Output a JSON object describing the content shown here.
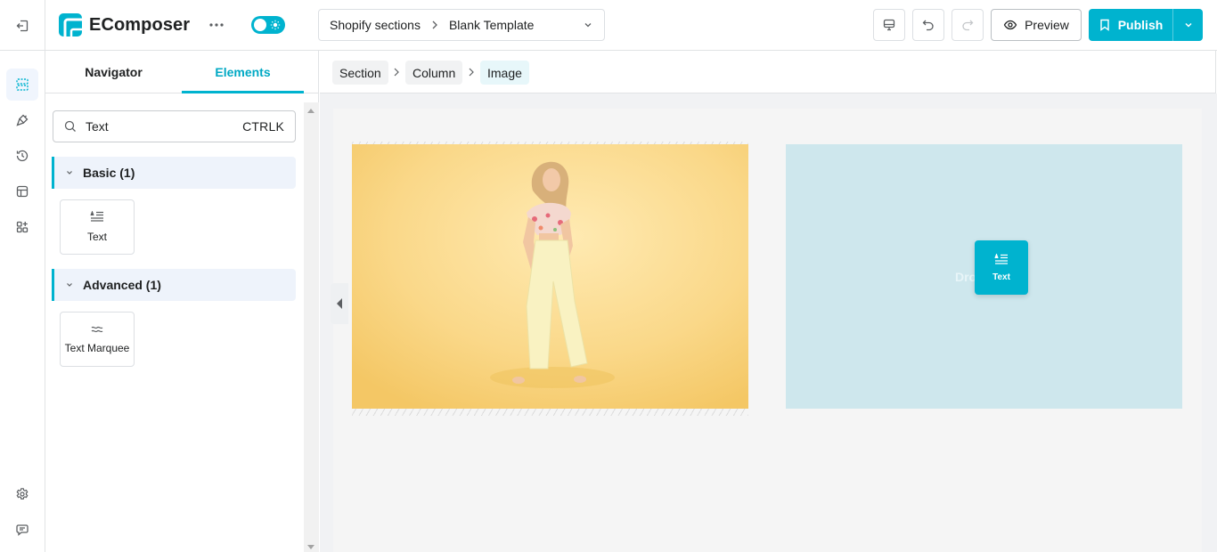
{
  "app": {
    "name": "EComposer",
    "brand_color": "#00b3cf",
    "theme_toggle": {
      "state": "on",
      "icon": "sun-icon"
    }
  },
  "header": {
    "template_selector": {
      "parent": "Shopify sections",
      "current": "Blank Template"
    },
    "actions": {
      "device_icon": "desktop-icon",
      "undo_icon": "undo-icon",
      "redo_icon": "redo-icon",
      "preview_label": "Preview",
      "publish_label": "Publish"
    }
  },
  "rail": {
    "items": [
      {
        "name": "layers",
        "icon": "sections-icon",
        "active": true
      },
      {
        "name": "styles",
        "icon": "brush-icon",
        "active": false
      },
      {
        "name": "history",
        "icon": "history-icon",
        "active": false
      },
      {
        "name": "layout",
        "icon": "layout-icon",
        "active": false
      },
      {
        "name": "apps",
        "icon": "add-apps-icon",
        "active": false
      }
    ],
    "bottom": [
      {
        "name": "settings",
        "icon": "gear-icon"
      },
      {
        "name": "chat",
        "icon": "chat-icon"
      }
    ]
  },
  "panel": {
    "tabs": [
      {
        "label": "Navigator",
        "active": false
      },
      {
        "label": "Elements",
        "active": true
      }
    ],
    "search": {
      "value": "Text",
      "shortcut": "CTRLK"
    },
    "groups": [
      {
        "label": "Basic (1)",
        "expanded": true,
        "elements": [
          {
            "label": "Text",
            "icon": "text-icon"
          }
        ]
      },
      {
        "label": "Advanced (1)",
        "expanded": true,
        "elements": [
          {
            "label": "Text Marquee",
            "icon": "marquee-icon"
          }
        ]
      }
    ]
  },
  "breadcrumb": [
    {
      "label": "Section"
    },
    {
      "label": "Column"
    },
    {
      "label": "Image",
      "current": true
    }
  ],
  "canvas": {
    "image_alt": "Woman in floral top and pale yellow trousers on yellow background",
    "drop_zone_text": "Drop",
    "dragging_element": {
      "label": "Text",
      "icon": "text-icon"
    }
  }
}
